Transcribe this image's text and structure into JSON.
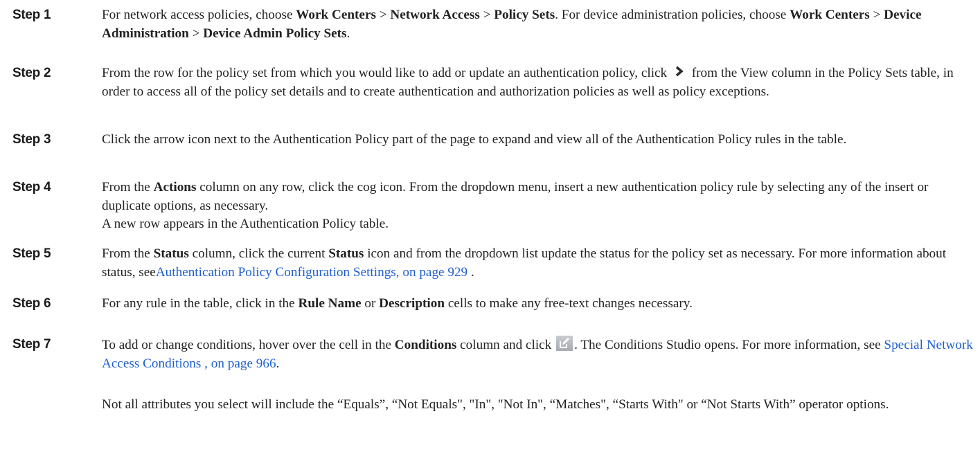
{
  "steps": [
    {
      "label": "Step 1",
      "text": {
        "a": "For network access policies, choose ",
        "b1": "Work Centers",
        "c": " > ",
        "b2": "Network Access",
        "d": " > ",
        "b3": "Policy Sets",
        "e": ". For device administration policies, choose ",
        "b4": "Work Centers",
        "f": " > ",
        "b5": "Device Administration",
        "g": " > ",
        "b6": "Device Admin Policy Sets",
        "h": "."
      }
    },
    {
      "label": "Step 2",
      "text": {
        "a": "From the row for the policy set from which you would like to add or update an authentication policy, click ",
        "icon": "chevron-right-icon",
        "b": " from the View column in the Policy Sets table, in order to access all of the policy set details and to create authentication and authorization policies as well as policy exceptions."
      }
    },
    {
      "label": "Step 3",
      "text": {
        "a": "Click the arrow icon next to the Authentication Policy part of the page to expand and view all of the Authentication Policy rules in the table."
      }
    },
    {
      "label": "Step 4",
      "text": {
        "a": "From the ",
        "b1": "Actions",
        "c": " column on any row, click the cog icon. From the dropdown menu, insert a new authentication policy rule by selecting any of the insert or duplicate options, as necessary.",
        "d": "A new row appears in the Authentication Policy table."
      }
    },
    {
      "label": "Step 5",
      "text": {
        "a": "From the ",
        "b1": "Status",
        "c": " column, click the current ",
        "b2": "Status",
        "d": " icon and from the dropdown list update the status for the policy set as necessary. For more information about status, see",
        "link": "Authentication Policy Configuration Settings, on page 929",
        "e": " ."
      }
    },
    {
      "label": "Step 6",
      "text": {
        "a": "For any rule in the table, click in the ",
        "b1": "Rule Name",
        "c": " or ",
        "b2": "Description",
        "d": " cells to make any free-text changes necessary."
      }
    },
    {
      "label": "Step 7",
      "text": {
        "a": "To add or change conditions, hover over the cell in the ",
        "b1": "Conditions",
        "c": " column and click ",
        "icon": "edit-icon",
        "d": ". The Conditions Studio opens. For more information, see ",
        "link": "Special Network Access Conditions , on page 966",
        "e": "."
      }
    }
  ],
  "note": "Not all attributes you select will include the “Equals”, “Not Equals\", \"In\", \"Not In\", “Matches\", “Starts With\" or “Not Starts With” operator options.",
  "colors": {
    "link": "#1f5fd1",
    "text": "#222222",
    "chevron": "#2b2b2b",
    "edit_icon_bg": "#b9bcc2"
  }
}
